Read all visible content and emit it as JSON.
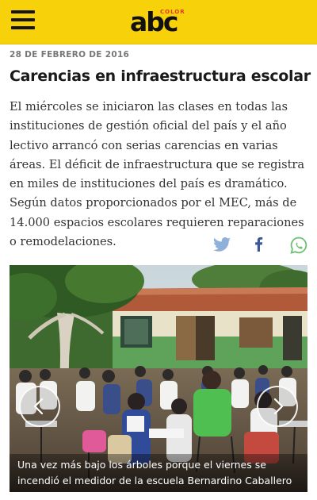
{
  "header": {
    "menu_icon": "hamburger-menu-icon",
    "logo_text": "abc",
    "logo_sub": "COLOR",
    "brand_color": "#f7d10a"
  },
  "article": {
    "date": "28 DE FEBRERO DE 2016",
    "title": "Carencias en infraestructura escolar",
    "body": "El miércoles se iniciaron las clases en todas las instituciones de gestión oficial del país y el año lectivo arrancó con serias carencias en varias áreas. El déficit de infraestructura que se registra en miles de instituciones del país es dramático. Según datos proporcionados por el MEC, más de 14.000 espacios escolares requieren reparaciones o remodelaciones."
  },
  "share": {
    "twitter_icon": "twitter-bird-icon",
    "facebook_icon": "facebook-f-icon",
    "whatsapp_icon": "whatsapp-icon",
    "twitter_color": "#8fb0d8",
    "facebook_color": "#3b5998",
    "whatsapp_color": "#6cc070"
  },
  "gallery": {
    "prev_icon": "chevron-left-icon",
    "next_icon": "chevron-right-icon",
    "caption": "Una vez más bajo los árboles porque el viernes se incendió el medidor de la escuela Bernardino Caballero de Luque. / ABC"
  }
}
